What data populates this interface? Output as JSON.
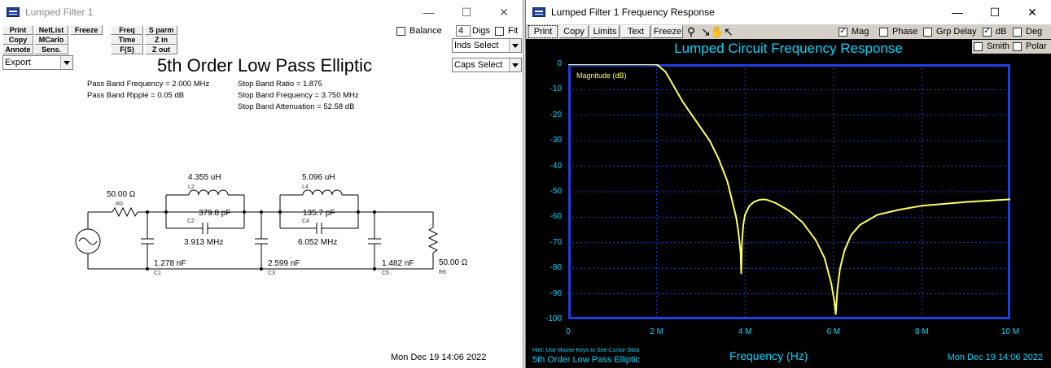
{
  "left_window": {
    "title": "Lumped Filter 1",
    "buttons": {
      "print": "Print",
      "netlist": "NetList",
      "freeze": "Freeze",
      "copy": "Copy",
      "mcarlo": "MCarlo",
      "annote": "Annote",
      "sens": "Sens.",
      "freq": "Freq",
      "time": "Time",
      "fs": "F(S)",
      "sparm": "S parm",
      "zin": "Z in",
      "zout": "Z out"
    },
    "export_select": "Export",
    "balance_label": "Balance",
    "digits_value": "4",
    "digits_label": "Digs",
    "fit_label": "Fit",
    "inds_select": "Inds Select",
    "caps_select": "Caps Select",
    "filter_title": "5th Order Low Pass Elliptic",
    "specs": {
      "pass_band_frequency": "Pass Band Frequency = 2.000 MHz",
      "pass_band_ripple": "Pass Band Ripple = 0.05 dB",
      "stop_band_ratio": "Stop Band Ratio = 1.875",
      "stop_band_frequency": "Stop Band Frequency = 3.750 MHz",
      "stop_band_attenuation": "Stop Band Attenuation = 52.58 dB"
    },
    "components": {
      "r0_value": "50.00 Ω",
      "r0_name": "R0",
      "l2_value": "4.355 uH",
      "l2_name": "L2",
      "c2_value": "379.8 pF",
      "c2_name": "C2",
      "c2_res": "3.913 MHz",
      "l4_value": "5.096 uH",
      "l4_name": "L4",
      "c4_value": "135.7 pF",
      "c4_name": "C4",
      "c4_res": "6.052 MHz",
      "c1_value": "1.278 nF",
      "c1_name": "C1",
      "c3_value": "2.599 nF",
      "c3_name": "C3",
      "c5_value": "1.482 nF",
      "c5_name": "C5",
      "r6_value": "50.00 Ω",
      "r6_name": "R6"
    },
    "timestamp": "Mon Dec 19 14:06 2022"
  },
  "right_window": {
    "title": "Lumped Filter 1 Frequency Response",
    "buttons": {
      "print": "Print",
      "copy": "Copy",
      "limits": "Limits",
      "text": "Text",
      "freeze": "Freeze"
    },
    "checks": {
      "mag": {
        "label": "Mag",
        "checked": true
      },
      "phase": {
        "label": "Phase",
        "checked": false
      },
      "grp_delay": {
        "label": "Grp Delay",
        "checked": false
      },
      "db": {
        "label": "dB",
        "checked": true
      },
      "deg": {
        "label": "Deg",
        "checked": false
      },
      "smith": {
        "label": "Smith",
        "checked": false
      },
      "polar": {
        "label": "Polar",
        "checked": false
      }
    },
    "plot_title": "Lumped Circuit Frequency Response",
    "legend": "Magnitude (dB)",
    "x_axis_label": "Frequency (Hz)",
    "hint": "Hint: Use Mouse Keys to See Cursor Data",
    "bottom_title": "5th Order Low Pass Elliptic",
    "timestamp": "Mon Dec 19 14:06 2022",
    "colors": {
      "background": "#000000",
      "grid": "#1f3fe0",
      "axis_text": "#00d7ff",
      "trace": "#ffff60"
    }
  },
  "chart_data": {
    "type": "line",
    "title": "Lumped Circuit Frequency Response",
    "xlabel": "Frequency (Hz)",
    "ylabel": "",
    "xlim": [
      0,
      10000000
    ],
    "ylim": [
      -100,
      0
    ],
    "x_tick_labels": [
      "0",
      "2 M",
      "4 M",
      "6 M",
      "8 M",
      "10 M"
    ],
    "y_tick_labels": [
      "0",
      "-10",
      "-20",
      "-30",
      "-40",
      "-50",
      "-60",
      "-70",
      "-80",
      "-90",
      "-100"
    ],
    "grid": true,
    "legend_placement": "top-left",
    "series": [
      {
        "name": "Magnitude (dB)",
        "x": [
          0,
          1000000,
          1800000,
          2000000,
          2200000,
          2400000,
          2600000,
          2800000,
          3000000,
          3200000,
          3400000,
          3600000,
          3800000,
          3850000,
          3900000,
          3913000,
          3930000,
          3960000,
          4000000,
          4100000,
          4200000,
          4300000,
          4400000,
          4500000,
          4700000,
          5000000,
          5300000,
          5600000,
          5800000,
          5950000,
          6020000,
          6052000,
          6090000,
          6150000,
          6250000,
          6400000,
          6600000,
          7000000,
          7500000,
          8000000,
          9000000,
          10000000
        ],
        "y": [
          0,
          0,
          0,
          -0.05,
          -3,
          -9,
          -15,
          -20,
          -25,
          -30,
          -37,
          -46,
          -60,
          -66,
          -74,
          -82,
          -70,
          -63,
          -59,
          -55.5,
          -54,
          -53.3,
          -53,
          -53.2,
          -54.5,
          -57.5,
          -62,
          -69,
          -76,
          -86,
          -93,
          -98,
          -88,
          -80,
          -73,
          -67,
          -63,
          -59,
          -57,
          -55.5,
          -54,
          -53
        ]
      }
    ]
  }
}
